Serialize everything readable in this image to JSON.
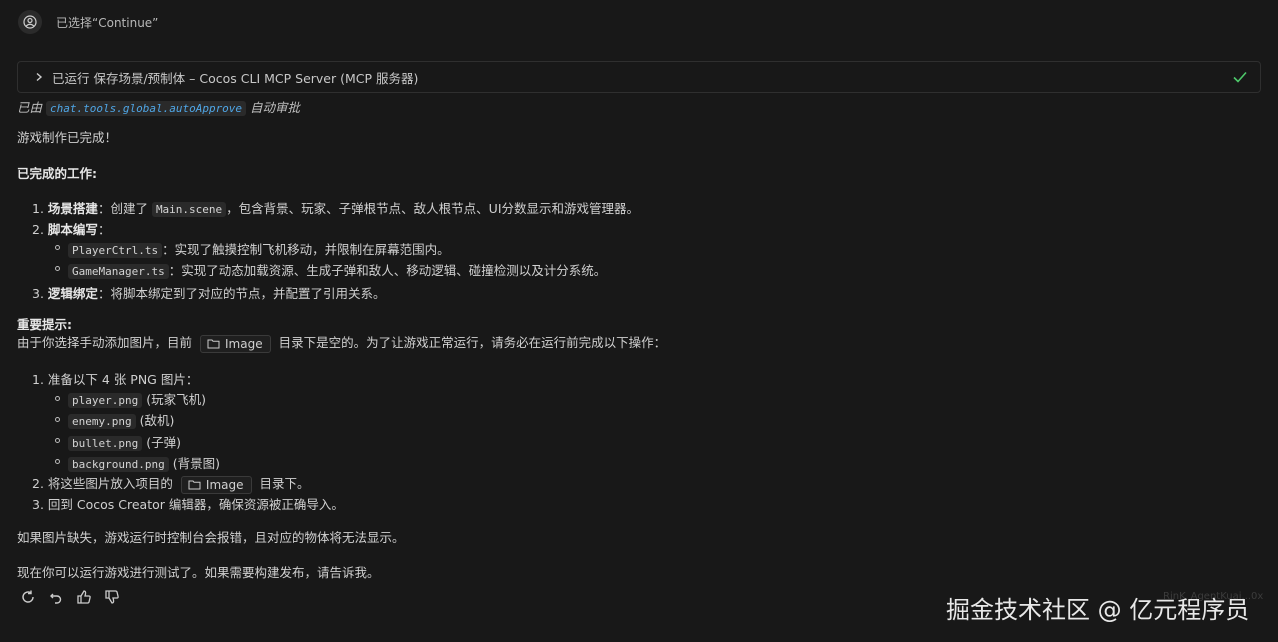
{
  "header": {
    "selected_label": "已选择“Continue”"
  },
  "tool": {
    "label": "已运行 保存场景/预制体 – Cocos CLI MCP Server (MCP 服务器)",
    "approved_prefix": "已由",
    "approved_code": "chat.tools.global.autoApprove",
    "approved_suffix": "自动审批"
  },
  "message": {
    "intro": "游戏制作已完成！",
    "done_heading": "已完成的工作:",
    "item1_num": "1.",
    "item1_bold": "场景搭建",
    "item1_a": "：创建了",
    "item1_code": "Main.scene",
    "item1_b": "，包含背景、玩家、子弹根节点、敌人根节点、UI分数显示和游戏管理器。",
    "item2_num": "2.",
    "item2_bold": "脚本编写",
    "item2_colon": "：",
    "item2_sub1_code": "PlayerCtrl.ts",
    "item2_sub1_text": "：实现了触摸控制飞机移动，并限制在屏幕范围内。",
    "item2_sub2_code": "GameManager.ts",
    "item2_sub2_text": "：实现了动态加载资源、生成子弹和敌人、移动逻辑、碰撞检测以及计分系统。",
    "item3_num": "3.",
    "item3_bold": "逻辑绑定",
    "item3_text": "：将脚本绑定到了对应的节点，并配置了引用关系。",
    "tip_heading": "重要提示:",
    "tip_a": "由于你选择手动添加图片，目前",
    "tip_folder": "Image",
    "tip_b": "目录下是空的。为了让游戏正常运行，请务必在运行前完成以下操作：",
    "step1_num": "1.",
    "step1_text": "准备以下 4 张 PNG 图片：",
    "files": [
      {
        "code": "player.png",
        "desc": "(玩家飞机)"
      },
      {
        "code": "enemy.png",
        "desc": "(敌机)"
      },
      {
        "code": "bullet.png",
        "desc": "(子弹)"
      },
      {
        "code": "background.png",
        "desc": "(背景图)"
      }
    ],
    "step2_num": "2.",
    "step2_a": "将这些图片放入项目的",
    "step2_folder": "Image",
    "step2_b": "目录下。",
    "step3_num": "3.",
    "step3_text": "回到 Cocos Creator 编辑器，确保资源被正确导入。",
    "warning": "如果图片缺失，游戏运行时控制台会报错，且对应的物体将无法显示。",
    "closing": "现在你可以运行游戏进行测试了。如果需要构建发布，请告诉我。"
  },
  "watermark": "掘金技术社区 @ 亿元程序员",
  "faint_text": "RinK_AgentKuai...0x",
  "colors": {
    "background": "#181818",
    "text": "#cccccc",
    "check": "#4ec96b",
    "link_code": "#4fa6e6"
  }
}
